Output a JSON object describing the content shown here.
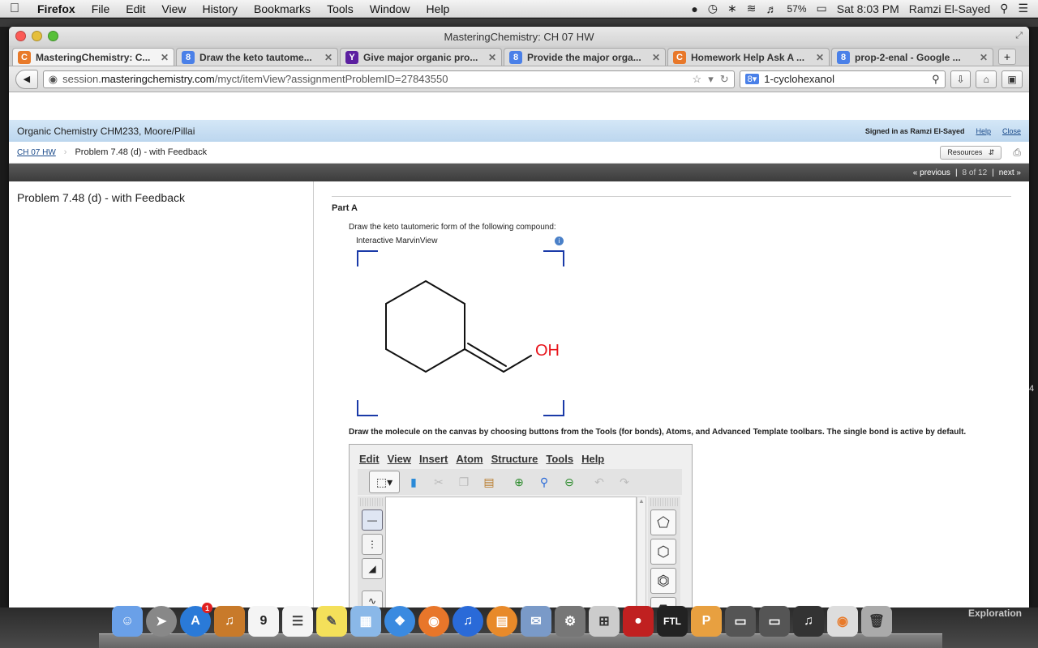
{
  "menubar": {
    "app_name": "Firefox",
    "items": [
      "File",
      "Edit",
      "View",
      "History",
      "Bookmarks",
      "Tools",
      "Window",
      "Help"
    ],
    "battery": "57%",
    "clock": "Sat 8:03 PM",
    "user": "Ramzi El-Sayed"
  },
  "window": {
    "title": "MasteringChemistry: CH 07 HW"
  },
  "tabs": [
    {
      "label": "MasteringChemistry: C...",
      "favicon": "mastering-icon",
      "color": "#e87a2a",
      "glyph": "C"
    },
    {
      "label": "Draw the keto tautome...",
      "favicon": "google-icon",
      "color": "#4a80e8",
      "glyph": "8"
    },
    {
      "label": "Give major organic pro...",
      "favicon": "yahoo-icon",
      "color": "#5b1fa0",
      "glyph": "Y"
    },
    {
      "label": "Provide the major orga...",
      "favicon": "google-icon",
      "color": "#4a80e8",
      "glyph": "8"
    },
    {
      "label": "Homework Help Ask A ...",
      "favicon": "chegg-icon",
      "color": "#e8782a",
      "glyph": "C"
    },
    {
      "label": "prop-2-enal - Google ...",
      "favicon": "google-icon",
      "color": "#4a80e8",
      "glyph": "8"
    }
  ],
  "url": {
    "prefix": "session.",
    "domain": "masteringchemistry.com",
    "path": "/myct/itemView?assignmentProblemID=27843550"
  },
  "search": {
    "value": "1-cyclohexanol"
  },
  "course": {
    "name": "Organic Chemistry CHM233, Moore/Pillai",
    "signed_in": "Signed in as Ramzi El-Sayed",
    "help": "Help",
    "close": "Close"
  },
  "breadcrumb": {
    "link": "CH 07 HW",
    "current": "Problem 7.48 (d) - with Feedback",
    "resources": "Resources"
  },
  "pager": {
    "previous": "« previous",
    "position": "8 of 12",
    "next": "next »"
  },
  "left_title": "Problem 7.48 (d) - with Feedback",
  "part": {
    "label": "Part A",
    "prompt": "Draw the keto tautomeric form of the following compound:",
    "viewer_label": "Interactive MarvinView",
    "atom_label": "OH",
    "instructions": "Draw the molecule on the canvas by choosing buttons from the Tools (for bonds), Atoms, and Advanced Template toolbars. The single bond is active by default."
  },
  "editor": {
    "menu": [
      "Edit",
      "View",
      "Insert",
      "Atom",
      "Structure",
      "Tools",
      "Help"
    ]
  },
  "dock": {
    "label": "Exploration",
    "calendar_day": "9",
    "badge": "1"
  },
  "colors": {
    "accent_blue": "#1a3aa8",
    "oh_red": "#e8141b"
  }
}
